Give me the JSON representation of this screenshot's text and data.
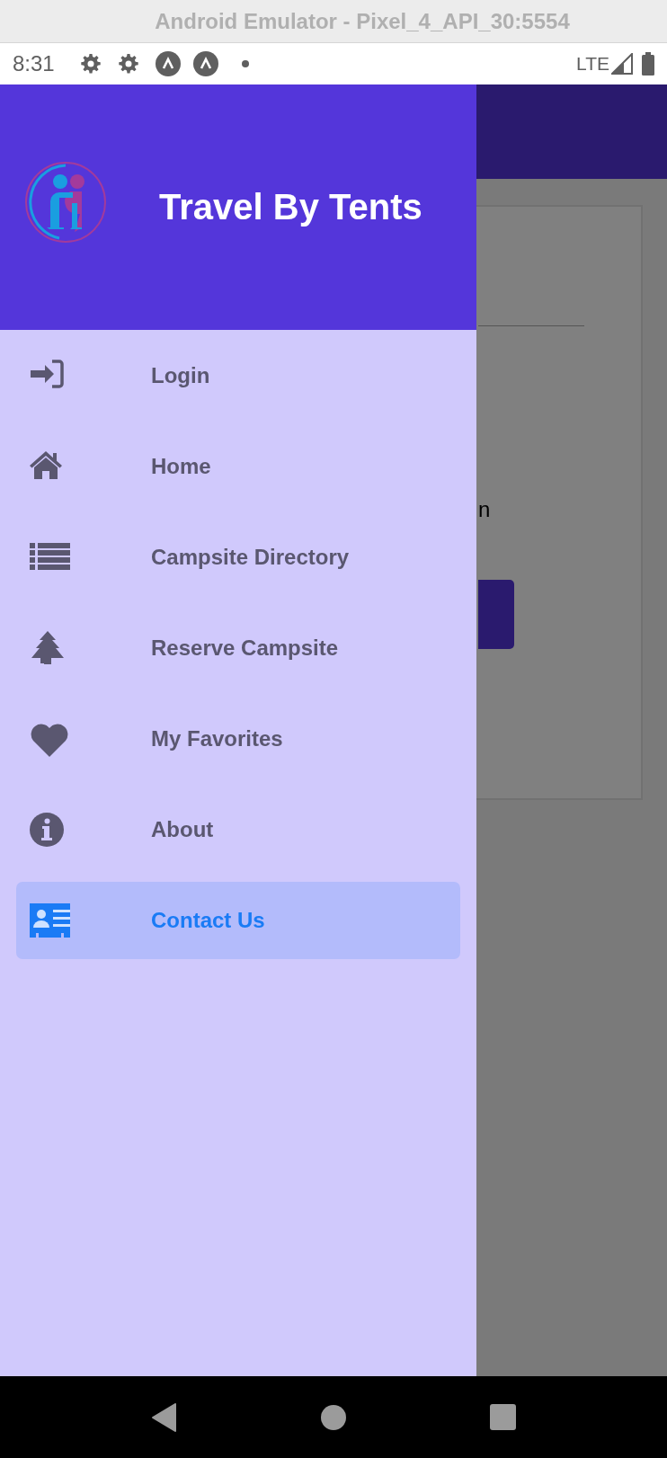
{
  "window": {
    "title": "Android Emulator - Pixel_4_API_30:5554"
  },
  "status_bar": {
    "time": "8:31",
    "network": "LTE"
  },
  "drawer": {
    "title": "Travel By Tents",
    "items": [
      {
        "label": "Login",
        "selected": false
      },
      {
        "label": "Home",
        "selected": false
      },
      {
        "label": "Campsite Directory",
        "selected": false
      },
      {
        "label": "Reserve Campsite",
        "selected": false
      },
      {
        "label": "My Favorites",
        "selected": false
      },
      {
        "label": "About",
        "selected": false
      },
      {
        "label": "Contact Us",
        "selected": true
      }
    ]
  },
  "background_screen": {
    "text_fragment": "n"
  }
}
